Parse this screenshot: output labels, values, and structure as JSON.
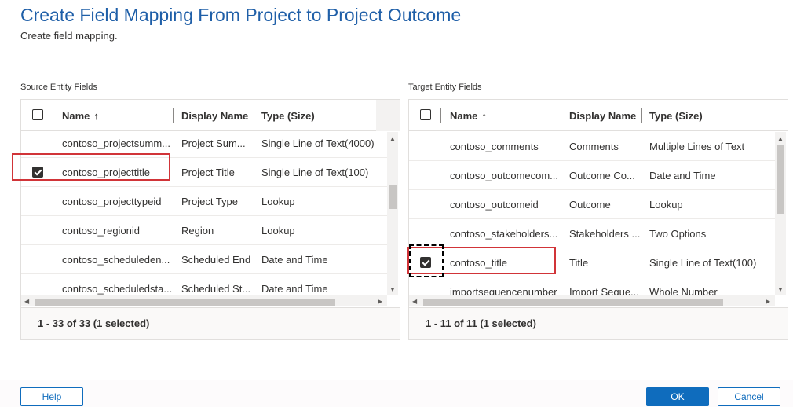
{
  "dialog": {
    "title": "Create Field Mapping From Project to Project Outcome",
    "subtitle": "Create field mapping."
  },
  "source": {
    "label": "Source Entity Fields",
    "headers": {
      "name": "Name",
      "sort_icon": "↑",
      "display": "Display Name",
      "type": "Type (Size)"
    },
    "rows": [
      {
        "name": "contoso_projectsumm...",
        "display": "Project Sum...",
        "type": "Single Line of Text(4000)",
        "checked": false
      },
      {
        "name": "contoso_projecttitle",
        "display": "Project Title",
        "type": "Single Line of Text(100)",
        "checked": true
      },
      {
        "name": "contoso_projecttypeid",
        "display": "Project Type",
        "type": "Lookup",
        "checked": false
      },
      {
        "name": "contoso_regionid",
        "display": "Region",
        "type": "Lookup",
        "checked": false
      },
      {
        "name": "contoso_scheduleden...",
        "display": "Scheduled End",
        "type": "Date and Time",
        "checked": false
      },
      {
        "name": "contoso_scheduledsta...",
        "display": "Scheduled St...",
        "type": "Date and Time",
        "checked": false
      }
    ],
    "footer": "1 - 33 of 33 (1 selected)"
  },
  "target": {
    "label": "Target Entity Fields",
    "headers": {
      "name": "Name",
      "sort_icon": "↑",
      "display": "Display Name",
      "type": "Type (Size)"
    },
    "rows": [
      {
        "name": "contoso_comments",
        "display": "Comments",
        "type": "Multiple Lines of Text",
        "checked": false
      },
      {
        "name": "contoso_outcomecom...",
        "display": "Outcome Co...",
        "type": "Date and Time",
        "checked": false
      },
      {
        "name": "contoso_outcomeid",
        "display": "Outcome",
        "type": "Lookup",
        "checked": false
      },
      {
        "name": "contoso_stakeholders...",
        "display": "Stakeholders ...",
        "type": "Two Options",
        "checked": false
      },
      {
        "name": "contoso_title",
        "display": "Title",
        "type": "Single Line of Text(100)",
        "checked": true
      },
      {
        "name": "importsequencenumber",
        "display": "Import Seque...",
        "type": "Whole Number",
        "checked": false
      }
    ],
    "footer": "1 - 11 of 11 (1 selected)"
  },
  "buttons": {
    "help": "Help",
    "ok": "OK",
    "cancel": "Cancel"
  },
  "icons": {
    "scroll_up": "▲",
    "scroll_down": "▼",
    "scroll_left": "◀",
    "scroll_right": "▶"
  },
  "colors": {
    "accent": "#0f6cbd",
    "title": "#1f5fa8",
    "highlight": "#d13438"
  }
}
